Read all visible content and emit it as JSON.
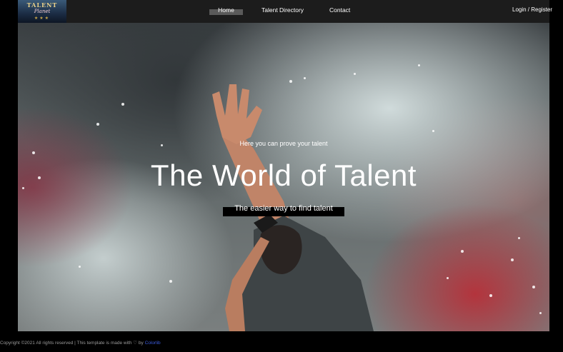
{
  "header": {
    "logo": {
      "top_text": "TALENT",
      "script_text": "Planet",
      "stars": "★★★"
    },
    "nav": [
      {
        "label": "Home"
      },
      {
        "label": "Talent Directory"
      },
      {
        "label": "Contact"
      }
    ],
    "login_label": "Login / Register"
  },
  "hero": {
    "tagline": "Here you can prove your talent",
    "title": "The World of Talent",
    "subtitle": "The easier way to find talent"
  },
  "footer": {
    "text": "Copyright ©2021 All rights reserved | This template is made with ♡ by ",
    "link_label": "Colorlib"
  },
  "colors": {
    "topbar": "#1c1c1c",
    "nav_active": "#5a5a5a",
    "footer_link": "#3b5bdb"
  }
}
